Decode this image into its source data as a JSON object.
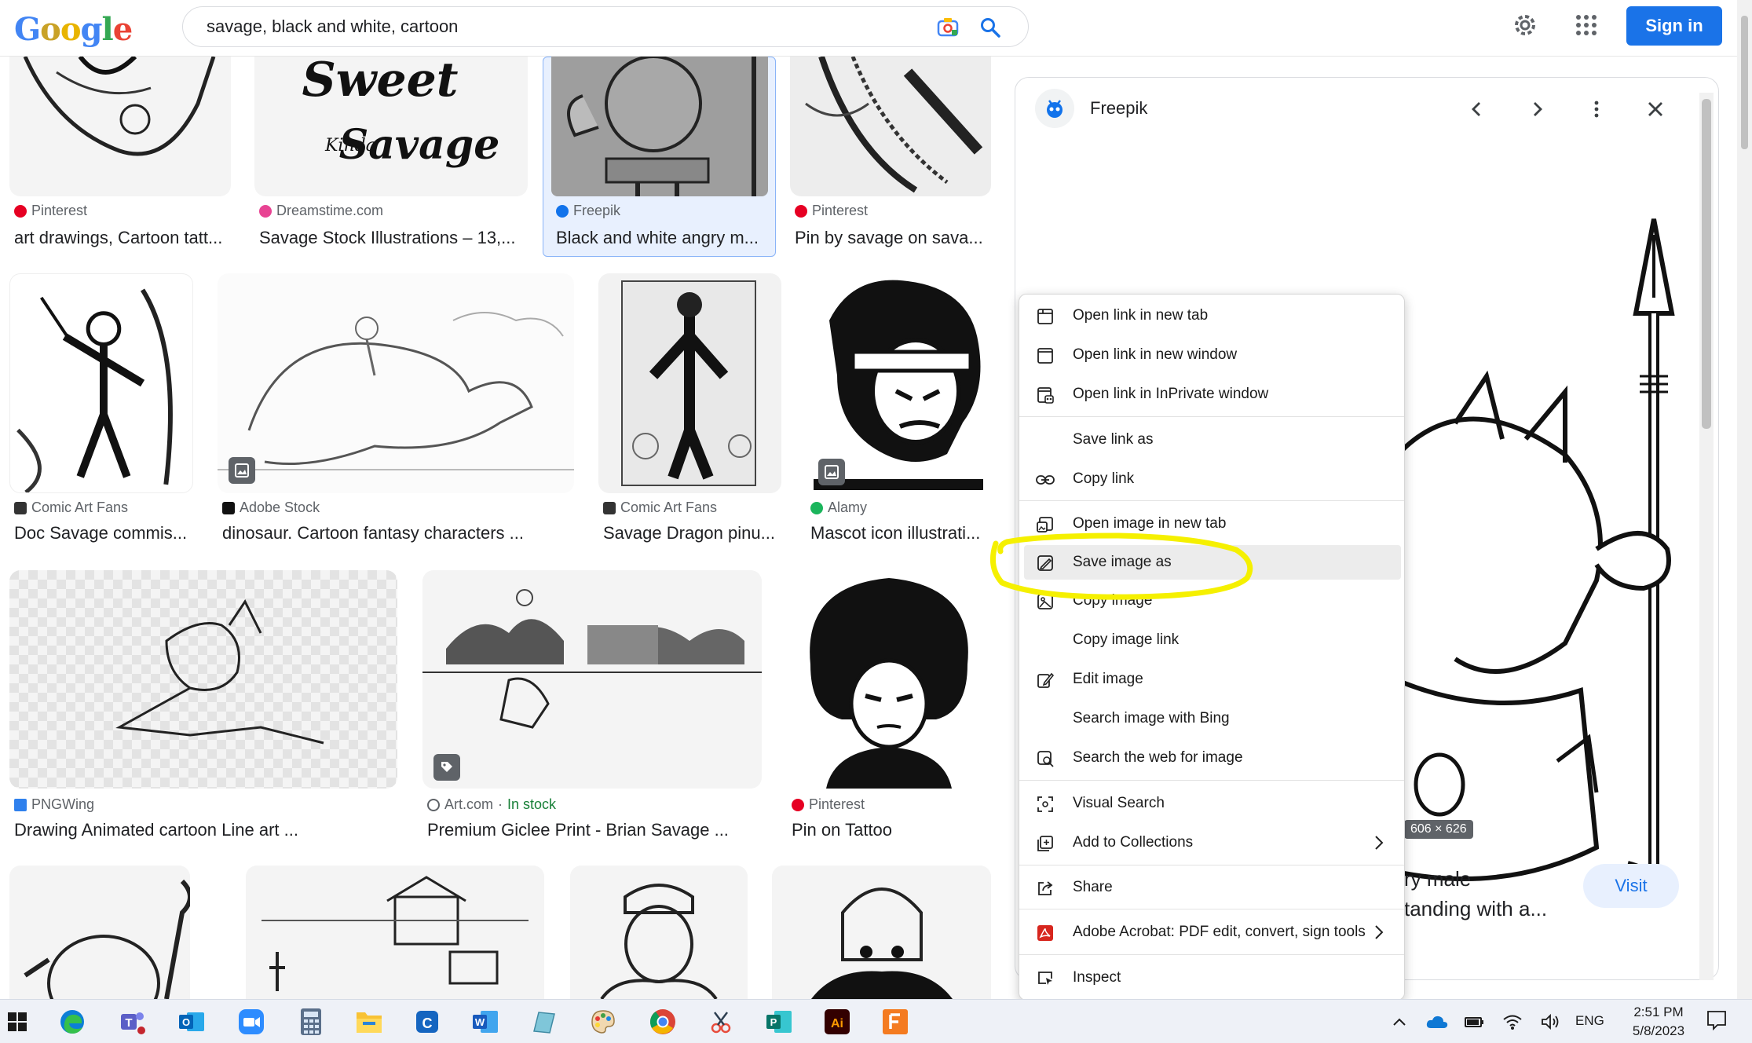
{
  "header": {
    "logo_text": "Google",
    "search_value": "savage, black and white, cartoon",
    "sign_in": "Sign in"
  },
  "results": [
    {
      "source": "Pinterest",
      "title": "art drawings, Cartoon tatt..."
    },
    {
      "source": "Dreamstime.com",
      "title": "Savage Stock Illustrations – 13,..."
    },
    {
      "source": "Freepik",
      "title": "Black and white angry m..."
    },
    {
      "source": "Pinterest",
      "title": "Pin by savage on sava..."
    },
    {
      "source": "Comic Art Fans",
      "title": "Doc Savage commis..."
    },
    {
      "source": "Adobe Stock",
      "title": "dinosaur. Cartoon fantasy characters ..."
    },
    {
      "source": "Comic Art Fans",
      "title": "Savage Dragon pinu..."
    },
    {
      "source": "Alamy",
      "title": "Mascot icon illustrati..."
    },
    {
      "source": "PNGWing",
      "title": "Drawing Animated cartoon Line art ..."
    },
    {
      "source": "Art.com",
      "stock": "In stock",
      "title": "Premium Giclee Print - Brian Savage ..."
    },
    {
      "source": "Pinterest",
      "title": "Pin on Tattoo"
    }
  ],
  "thumb_text": {
    "sweet": "Sweet",
    "kinda": "Kinda",
    "savage": "Savage"
  },
  "panel": {
    "source": "Freepik",
    "dimensions": "606 × 626",
    "title_line1": "ry male",
    "title_line2": "tanding with a...",
    "visit": "Visit"
  },
  "context_menu": [
    {
      "label": "Open link in new tab",
      "icon": "new-tab-icon"
    },
    {
      "label": "Open link in new window",
      "icon": "new-window-icon"
    },
    {
      "label": "Open link in InPrivate window",
      "icon": "inprivate-icon"
    },
    {
      "label": "Save link as",
      "icon": ""
    },
    {
      "label": "Copy link",
      "icon": "link-icon"
    },
    {
      "label": "Open image in new tab",
      "icon": "image-new-tab-icon"
    },
    {
      "label": "Save image as",
      "icon": "save-image-icon"
    },
    {
      "label": "Copy image",
      "icon": "copy-image-icon"
    },
    {
      "label": "Copy image link",
      "icon": ""
    },
    {
      "label": "Edit image",
      "icon": "edit-image-icon"
    },
    {
      "label": "Search image with Bing",
      "icon": ""
    },
    {
      "label": "Search the web for image",
      "icon": "image-search-icon"
    },
    {
      "label": "Visual Search",
      "icon": "visual-search-icon"
    },
    {
      "label": "Add to Collections",
      "icon": "collections-icon"
    },
    {
      "label": "Share",
      "icon": "share-icon"
    },
    {
      "label": "Adobe Acrobat: PDF edit, convert, sign tools",
      "icon": "acrobat-icon"
    },
    {
      "label": "Inspect",
      "icon": "inspect-icon"
    }
  ],
  "taskbar": {
    "lang": "ENG",
    "time": "2:51 PM",
    "date": "5/8/2023",
    "illustrator_label": "Ai",
    "outlook_label": "O",
    "word_label": "W",
    "publisher_label": "P",
    "cisco_label": "C"
  },
  "colors": {
    "accent": "#1a73e8",
    "highlight_annotation": "#f5f000",
    "selected_card": "#e8f0fe"
  }
}
